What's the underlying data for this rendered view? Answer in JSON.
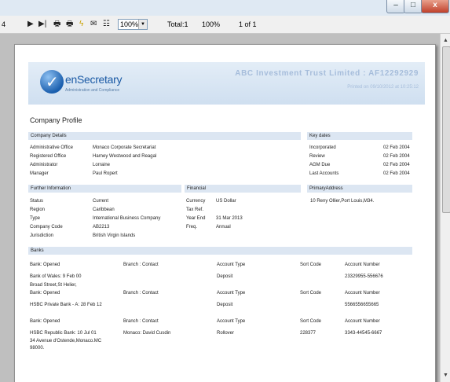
{
  "toolbar": {
    "page_indicator": "4",
    "zoom_value": "100%",
    "total": "Total:1",
    "zoom_percent": "100%",
    "page_of": "1 of 1"
  },
  "window": {
    "minimize": "–",
    "maximize": "□",
    "close": "x"
  },
  "icons": [
    "play-next-icon",
    "last-page-icon",
    "print-icon",
    "print-setup-icon",
    "lightning-icon",
    "email-icon",
    "tree-icon"
  ],
  "header": {
    "logo_main": "enSecretary",
    "logo_sub": "Administration and Compliance",
    "title": "ABC Investment Trust Limited : AF12292929",
    "printed": "Printed on 09/10/2012 at 10:25:12"
  },
  "report_title": "Company Profile",
  "company_details": {
    "heading": "Company Details",
    "rows": [
      {
        "label": "Administrative Office",
        "value": "Monaco Corporate Secretariat"
      },
      {
        "label": "Registered Office",
        "value": "Harney Westwood and Reagal"
      },
      {
        "label": "Administrator",
        "value": "Lorraine"
      },
      {
        "label": "Manager",
        "value": "Paul Ropert"
      }
    ]
  },
  "key_dates": {
    "heading": "Key dates",
    "rows": [
      {
        "label": "Incorporated",
        "value": "02 Feb 2004"
      },
      {
        "label": "Review",
        "value": "02 Feb 2004"
      },
      {
        "label": "AGM Due",
        "value": "02 Feb 2004"
      },
      {
        "label": "Last Accounts",
        "value": "02 Feb 2004"
      }
    ]
  },
  "further_info": {
    "heading": "Further Information",
    "rows": [
      {
        "label": "Status",
        "value": "Current"
      },
      {
        "label": "Region",
        "value": "Caribbean"
      },
      {
        "label": "Type",
        "value": "International Business Company"
      },
      {
        "label": "Company Code",
        "value": "AB2213"
      },
      {
        "label": "Jurisdiction",
        "value": "British Virgin Islands"
      }
    ]
  },
  "financial": {
    "heading": "Financial",
    "rows": [
      {
        "label": "Currency",
        "value": "US Dollar"
      },
      {
        "label": "Tax Ref.",
        "value": ""
      },
      {
        "label": "Year End",
        "value": "31 Mar 2013"
      },
      {
        "label": "Freq.",
        "value": "Annual"
      }
    ]
  },
  "primary_address": {
    "heading": "PrimaryAddress",
    "value": "10 Reny Ollier,Port Louis,M34."
  },
  "banks": {
    "heading": "Banks",
    "col_opened": "Bank: Opened",
    "col_branch": "Branch : Contact",
    "col_type": "Account Type",
    "col_sort": "Sort Code",
    "col_number": "Account Number",
    "entries": [
      {
        "bank": "Bank of Wales: 9 Feb 00",
        "addr1": "Broad Street,St Helier,",
        "addr2": "",
        "branch": "",
        "type": "Deposit",
        "sort": "",
        "number": "23329955-556676"
      },
      {
        "bank": "HSBC Private Bank - A: 28 Feb 12",
        "addr1": "",
        "addr2": "",
        "branch": "",
        "type": "Deposit",
        "sort": "",
        "number": "5566556655665"
      },
      {
        "bank": "HSBC Republic Bank: 10 Jul 01",
        "addr1": "34 Avenue d'Ostende,Monaco.MC",
        "addr2": "98000.",
        "branch": "Monaco: David Cusdin",
        "type": "Rollover",
        "sort": "228377",
        "number": "3343-44545-6667"
      }
    ]
  }
}
